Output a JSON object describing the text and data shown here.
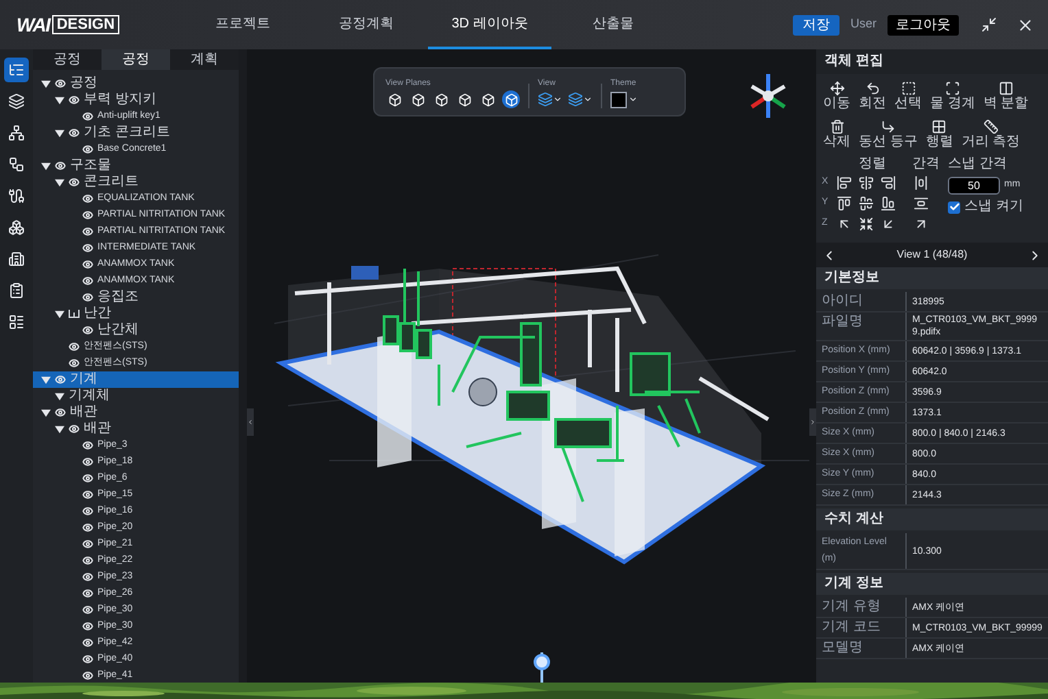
{
  "logo": {
    "mark": "WAI",
    "word": "DESIGN"
  },
  "nav": [
    {
      "label": "프로젝트",
      "selected": false
    },
    {
      "label": "공정계획",
      "selected": false
    },
    {
      "label": "3D 레이아웃",
      "selected": true
    },
    {
      "label": "산출물",
      "selected": false
    }
  ],
  "header_actions": {
    "save": "저장",
    "user": "User",
    "logout": "로그아웃"
  },
  "rail": [
    {
      "selected": true
    },
    {
      "selected": false
    },
    {
      "selected": false
    },
    {
      "selected": false
    },
    {
      "selected": false
    },
    {
      "selected": false
    },
    {
      "selected": false
    },
    {
      "selected": false
    },
    {
      "selected": false
    }
  ],
  "panel_tabs": [
    {
      "label": "공정",
      "selected": false
    },
    {
      "label": "공정",
      "selected": true
    },
    {
      "label": "계획",
      "selected": false
    }
  ],
  "tree": [
    {
      "label": "공정",
      "kind": "eye",
      "expanded": true,
      "selected": false,
      "children": [
        {
          "label": "부력 방지키",
          "kind": "eye",
          "expanded": true,
          "selected": false,
          "children": [
            {
              "label": "Anti-uplift key1",
              "kind": "eye",
              "selected": false
            }
          ]
        },
        {
          "label": "기초 콘크리트",
          "kind": "eye",
          "expanded": true,
          "selected": false,
          "children": [
            {
              "label": "Base Concrete1",
              "kind": "eye",
              "selected": false
            }
          ]
        }
      ]
    },
    {
      "label": "구조물",
      "kind": "eye",
      "expanded": true,
      "selected": false,
      "children": [
        {
          "label": "콘크리트",
          "kind": "eye",
          "expanded": true,
          "selected": false,
          "children": [
            {
              "label": "EQUALIZATION TANK",
              "kind": "eye",
              "selected": false
            },
            {
              "label": "PARTIAL NITRITATION TANK",
              "kind": "eye",
              "selected": false
            },
            {
              "label": "PARTIAL NITRITATION TANK",
              "kind": "eye",
              "selected": false
            },
            {
              "label": "INTERMEDIATE TANK",
              "kind": "eye",
              "selected": false
            },
            {
              "label": "ANAMMOX TANK",
              "kind": "eye",
              "selected": false
            },
            {
              "label": "ANAMMOX TANK",
              "kind": "eye",
              "selected": false
            },
            {
              "label": "응집조",
              "kind": "eye",
              "selected": false
            }
          ]
        },
        {
          "label": "난간",
          "kind": "railing",
          "expanded": true,
          "selected": false,
          "children": [
            {
              "label": "난간체",
              "kind": "eye",
              "selected": false
            }
          ]
        },
        {
          "label": "안전펜스(STS)",
          "kind": "eye",
          "selected": false
        },
        {
          "label": "안전펜스(STS)",
          "kind": "eye",
          "selected": false
        }
      ]
    },
    {
      "label": "기계",
      "kind": "eye",
      "expanded": true,
      "selected": true,
      "children": [
        {
          "label": "기계체",
          "kind": "plain",
          "expanded": true,
          "selected": false
        }
      ]
    },
    {
      "label": "배관",
      "kind": "eye",
      "expanded": true,
      "selected": false,
      "children": [
        {
          "label": "배관",
          "kind": "eye",
          "expanded": true,
          "selected": false,
          "children": [
            {
              "label": "Pipe_3",
              "kind": "eye",
              "selected": false
            },
            {
              "label": "Pipe_18",
              "kind": "eye",
              "selected": false
            },
            {
              "label": "Pipe_6",
              "kind": "eye",
              "selected": false
            },
            {
              "label": "Pipe_15",
              "kind": "eye",
              "selected": false
            },
            {
              "label": "Pipe_16",
              "kind": "eye",
              "selected": false
            },
            {
              "label": "Pipe_20",
              "kind": "eye",
              "selected": false
            },
            {
              "label": "Pipe_21",
              "kind": "eye",
              "selected": false
            },
            {
              "label": "Pipe_22",
              "kind": "eye",
              "selected": false
            },
            {
              "label": "Pipe_23",
              "kind": "eye",
              "selected": false
            },
            {
              "label": "Pipe_26",
              "kind": "eye",
              "selected": false
            },
            {
              "label": "Pipe_30",
              "kind": "eye",
              "selected": false
            },
            {
              "label": "Pipe_30",
              "kind": "eye",
              "selected": false
            },
            {
              "label": "Pipe_42",
              "kind": "eye",
              "selected": false
            },
            {
              "label": "Pipe_40",
              "kind": "eye",
              "selected": false
            },
            {
              "label": "Pipe_41",
              "kind": "eye",
              "selected": false
            }
          ]
        }
      ]
    }
  ],
  "toolbar": {
    "view_planes_label": "View Planes",
    "view_label": "View",
    "theme_label": "Theme",
    "view_planes": [
      {
        "selected": false
      },
      {
        "selected": false
      },
      {
        "selected": false
      },
      {
        "selected": false
      },
      {
        "selected": false
      },
      {
        "selected": true
      }
    ]
  },
  "object_edit": {
    "title": "객체 편집",
    "tools": [
      {
        "label": "이동",
        "kind": "move"
      },
      {
        "label": "회전",
        "kind": "rotate"
      },
      {
        "label": "선택",
        "kind": "select"
      },
      {
        "label": "물 경계",
        "kind": "boundary"
      },
      {
        "label": "벽 분할",
        "kind": "split"
      },
      {
        "label": "삭제",
        "kind": "delete"
      },
      {
        "label": "동선 등구",
        "kind": "route"
      },
      {
        "label": "행렬",
        "kind": "array"
      },
      {
        "label": "거리 측정",
        "kind": "measure"
      }
    ],
    "align_label": "정렬",
    "spacing_label": "간격",
    "axes": [
      "X",
      "Y",
      "Z"
    ],
    "snap_label": "스냅 간격",
    "snap_value": "50",
    "snap_unit": "mm",
    "snap_toggle": {
      "label": "스냅 켜기",
      "checked": true
    }
  },
  "view_nav": {
    "label": "View 1 (48/48)"
  },
  "sections": [
    {
      "title": "기본정보",
      "rows": [
        {
          "label": "아이디",
          "value": "318995"
        },
        {
          "label": "파일명",
          "value": "M_CTR0103_VM_BKT_99999.pdifx"
        },
        {
          "label": "Position X (mm)",
          "value": "60642.0 | 3596.9 | 1373.1"
        },
        {
          "label": "Position Y (mm)",
          "value": "60642.0"
        },
        {
          "label": "Position Z (mm)",
          "value": "3596.9"
        },
        {
          "label": "Position Z (mm)",
          "value": "1373.1"
        },
        {
          "label": "Size X (mm)",
          "value": "800.0 | 840.0 | 2146.3"
        },
        {
          "label": "Size X (mm)",
          "value": "800.0"
        },
        {
          "label": "Size Y (mm)",
          "value": "840.0"
        },
        {
          "label": "Size Z (mm)",
          "value": "2144.3"
        }
      ]
    },
    {
      "title": "수치 계산",
      "rows": [
        {
          "label": "Elevation Level (m)",
          "value": "10.300"
        }
      ]
    },
    {
      "title": "기계 정보",
      "rows": [
        {
          "label": "기계 유형",
          "value": "AMX 케이연"
        },
        {
          "label": "기계 코드",
          "value": "M_CTR0103_VM_BKT_99999"
        },
        {
          "label": "모델명",
          "value": "AMX 케이연"
        }
      ]
    }
  ]
}
